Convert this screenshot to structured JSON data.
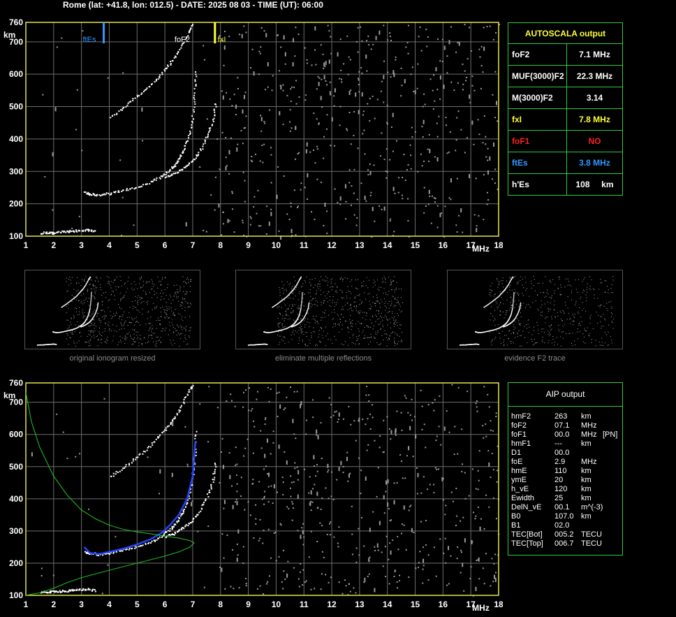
{
  "header": "Rome (lat: +41.8, lon: 012.5) - DATE: 2025 08 03 - TIME (UT): 06:00",
  "autoscala": {
    "title": "AUTOSCALA output",
    "rows": [
      {
        "label": "foF2",
        "value": "7.1 MHz",
        "color": "#ffffff"
      },
      {
        "label": "MUF(3000)F2",
        "value": "22.3 MHz",
        "color": "#ffffff"
      },
      {
        "label": "M(3000)F2",
        "value": "3.14",
        "color": "#ffffff"
      },
      {
        "label": "fxI",
        "value": "7.8 MHz",
        "color": "#ffff33"
      },
      {
        "label": "foF1",
        "value": "NO",
        "color": "#ff2020"
      },
      {
        "label": "ftEs",
        "value": "3.8 MHz",
        "color": "#3399ff"
      },
      {
        "label": "h'Es",
        "value": "108     km",
        "color": "#ffffff"
      }
    ]
  },
  "thumbnails": [
    {
      "caption": "original ionogram resized"
    },
    {
      "caption": "eliminate multiple reflections"
    },
    {
      "caption": "evidence F2 trace"
    }
  ],
  "aip": {
    "title": "AIP output",
    "rows": [
      {
        "name": "hmF2",
        "value": "263",
        "unit": "km",
        "extra": ""
      },
      {
        "name": "foF2",
        "value": "07.1",
        "unit": "MHz",
        "extra": ""
      },
      {
        "name": "foF1",
        "value": "00.0",
        "unit": "MHz",
        "extra": "[PN]"
      },
      {
        "name": "hmF1",
        "value": "---",
        "unit": "km",
        "extra": ""
      },
      {
        "name": "D1",
        "value": "00.0",
        "unit": "",
        "extra": ""
      },
      {
        "name": "foE",
        "value": "2.9",
        "unit": "MHz",
        "extra": ""
      },
      {
        "name": "hmE",
        "value": "110",
        "unit": "km",
        "extra": ""
      },
      {
        "name": "ymE",
        "value": "20",
        "unit": "km",
        "extra": ""
      },
      {
        "name": "h_vE",
        "value": "120",
        "unit": "km",
        "extra": ""
      },
      {
        "name": "Ewidth",
        "value": "25",
        "unit": "km",
        "extra": ""
      },
      {
        "name": "DelN_vE",
        "value": "00.1",
        "unit": "m^(-3)",
        "extra": ""
      },
      {
        "name": "B0",
        "value": "107.0",
        "unit": "km",
        "extra": ""
      },
      {
        "name": "B1",
        "value": "02.0",
        "unit": "",
        "extra": ""
      },
      {
        "name": "TEC[Bot]",
        "value": "005.2",
        "unit": "TECU",
        "extra": ""
      },
      {
        "name": "TEC[Top]",
        "value": "006.7",
        "unit": "TECU",
        "extra": ""
      }
    ]
  },
  "colors": {
    "axis": "#e6e650",
    "grid": "#6e6e6e",
    "trace": "#ffffff",
    "ftEs": "#3399ff",
    "fxI": "#ffff33",
    "profile": "#22cc22",
    "fit": "#2244ff"
  },
  "chart_data": [
    {
      "type": "scatter",
      "title": "",
      "xlabel": "MHz",
      "ylabel": "km",
      "xlim": [
        1,
        18
      ],
      "ylim": [
        100,
        760
      ],
      "xticks": [
        1,
        2,
        3,
        4,
        5,
        6,
        7,
        8,
        9,
        10,
        11,
        12,
        13,
        14,
        15,
        16,
        17,
        18
      ],
      "xtick_labels": [
        "1",
        "2",
        "3",
        "4",
        "5",
        "6",
        "7",
        "8",
        "9",
        "10",
        "11",
        "12",
        "13",
        "14",
        "15",
        "16",
        "17",
        "18"
      ],
      "yticks": [
        100,
        200,
        300,
        400,
        500,
        600,
        700,
        760
      ],
      "ytick_labels": [
        "100",
        "200",
        "300",
        "400",
        "500",
        "600",
        "700",
        "760"
      ],
      "markers": [
        {
          "label": "ftEs",
          "x": 3.8,
          "color": "#3399ff"
        },
        {
          "label": "foF2",
          "x": 7.1,
          "color": "#ffffff"
        },
        {
          "label": "fxI",
          "x": 7.8,
          "color": "#ffff33"
        }
      ],
      "series": [
        {
          "x": [
            1.5,
            1.8,
            2.0,
            2.3,
            2.6,
            2.9,
            3.2,
            3.5
          ],
          "y": [
            112,
            114,
            113,
            116,
            118,
            120,
            122,
            117
          ]
        },
        {
          "x": [
            3.1,
            3.3,
            3.6,
            4.0,
            4.5,
            5.0,
            5.5,
            5.9,
            6.2,
            6.4,
            6.6,
            6.8,
            6.95,
            7.05,
            7.1
          ],
          "y": [
            238,
            232,
            230,
            235,
            245,
            255,
            270,
            290,
            310,
            330,
            360,
            400,
            460,
            540,
            620
          ]
        },
        {
          "x": [
            6.0,
            6.3,
            6.6,
            6.9,
            7.2,
            7.5,
            7.7,
            7.8
          ],
          "y": [
            285,
            295,
            310,
            330,
            360,
            410,
            460,
            520
          ]
        },
        {
          "x": [
            4.0,
            4.5,
            5.0,
            5.5,
            5.9,
            6.2,
            6.5,
            6.8,
            7.0
          ],
          "y": [
            470,
            500,
            535,
            570,
            610,
            640,
            680,
            730,
            760
          ]
        }
      ]
    },
    {
      "type": "scatter",
      "title": "",
      "xlabel": "MHz",
      "ylabel": "km",
      "xlim": [
        1,
        18
      ],
      "ylim": [
        100,
        760
      ],
      "xticks": [
        1,
        2,
        3,
        4,
        5,
        6,
        7,
        8,
        9,
        10,
        11,
        12,
        13,
        14,
        15,
        16,
        17,
        18
      ],
      "yticks": [
        100,
        200,
        300,
        400,
        500,
        600,
        700,
        760
      ],
      "series": [
        {
          "x": [
            1.5,
            1.8,
            2.0,
            2.3,
            2.6,
            2.9,
            3.2,
            3.5
          ],
          "y": [
            112,
            114,
            113,
            116,
            118,
            120,
            122,
            117
          ]
        },
        {
          "x": [
            3.1,
            3.3,
            3.6,
            4.0,
            4.5,
            5.0,
            5.5,
            5.9,
            6.2,
            6.4,
            6.6,
            6.8,
            6.95,
            7.05,
            7.1
          ],
          "y": [
            238,
            232,
            230,
            235,
            245,
            255,
            270,
            290,
            310,
            330,
            360,
            400,
            460,
            540,
            620
          ]
        },
        {
          "x": [
            6.0,
            6.3,
            6.6,
            6.9,
            7.2,
            7.5,
            7.7,
            7.8
          ],
          "y": [
            285,
            295,
            310,
            330,
            360,
            410,
            460,
            520
          ]
        },
        {
          "x": [
            4.0,
            4.5,
            5.0,
            5.5,
            5.9,
            6.2,
            6.5,
            6.8,
            7.0
          ],
          "y": [
            470,
            500,
            535,
            570,
            610,
            640,
            680,
            730,
            760
          ]
        },
        {
          "type": "line",
          "color": "#2244ff",
          "x": [
            3.1,
            3.3,
            3.6,
            4.0,
            4.5,
            5.0,
            5.5,
            5.9,
            6.2,
            6.5,
            6.8,
            7.0,
            7.1
          ],
          "y": [
            250,
            232,
            228,
            235,
            245,
            258,
            275,
            295,
            320,
            350,
            400,
            470,
            580
          ]
        },
        {
          "type": "line",
          "color": "#22cc22",
          "x": [
            1.0,
            1.2,
            1.5,
            2.0,
            2.5,
            3.0,
            3.5,
            4.0,
            4.5,
            5.0,
            5.5,
            6.0,
            6.5,
            6.9,
            7.05,
            6.9,
            6.5,
            6.0,
            5.0,
            4.0,
            3.0,
            2.5,
            2.0,
            1.5,
            1.0
          ],
          "y": [
            730,
            640,
            560,
            470,
            410,
            365,
            338,
            318,
            305,
            297,
            291,
            284,
            278,
            270,
            263,
            250,
            235,
            222,
            200,
            178,
            155,
            140,
            122,
            108,
            100
          ]
        }
      ]
    }
  ]
}
